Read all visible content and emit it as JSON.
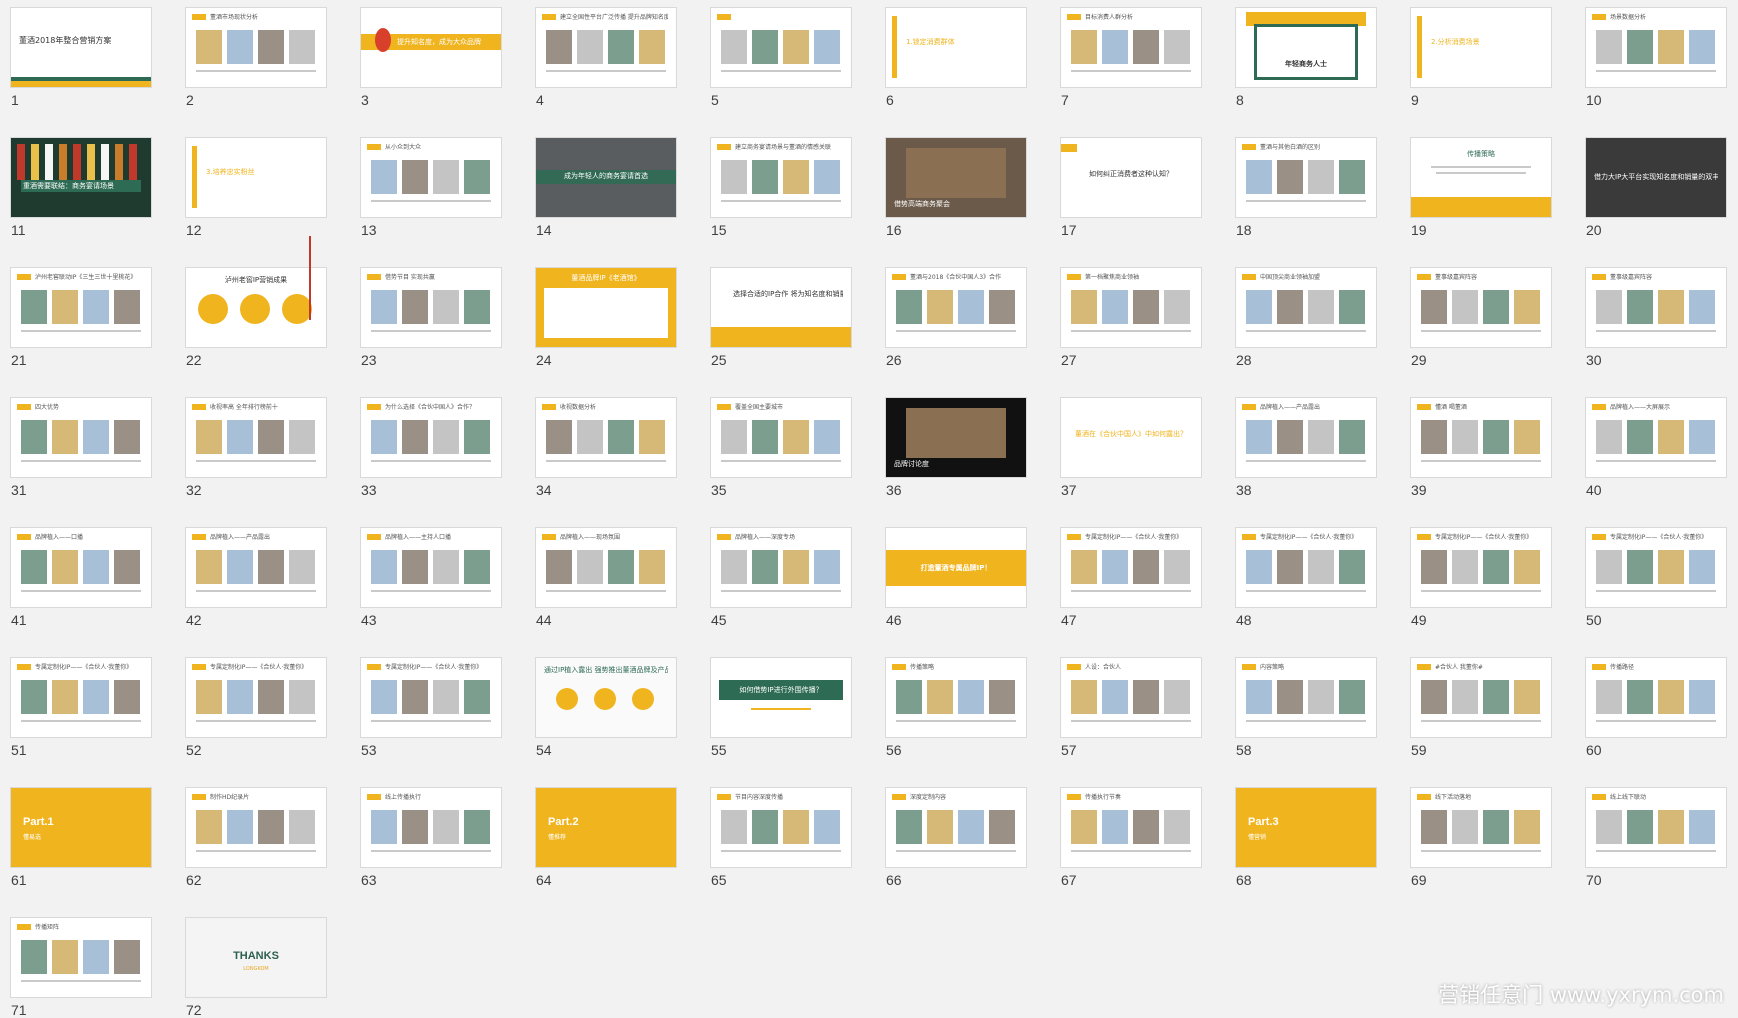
{
  "colors": {
    "background": "#f2f2f2",
    "accent_yellow": "#f0b41e",
    "brand_green": "#2e6b55",
    "dark": "#2b2b2b"
  },
  "slides": [
    {
      "number": "1",
      "style": "title",
      "text": "董酒2018年整合营销方案"
    },
    {
      "number": "2",
      "style": "content",
      "text": "董酒市场现状分析"
    },
    {
      "number": "3",
      "style": "band-yellow",
      "text": "提升知名度，成为大众品牌"
    },
    {
      "number": "4",
      "style": "image",
      "text": "建立全国性平台广泛传播 提升品牌知名度"
    },
    {
      "number": "5",
      "style": "green-blocks",
      "text": ""
    },
    {
      "number": "6",
      "style": "vbar",
      "text": "1.锁定消费群体"
    },
    {
      "number": "7",
      "style": "content",
      "text": "目标消费人群分析"
    },
    {
      "number": "8",
      "style": "green-frame",
      "text": "年轻商务人士"
    },
    {
      "number": "9",
      "style": "vbar",
      "text": "2.分析消费场景"
    },
    {
      "number": "10",
      "style": "content",
      "text": "场景数据分析"
    },
    {
      "number": "11",
      "style": "dark-band",
      "text": "重酒需要联结：商务宴请场景"
    },
    {
      "number": "12",
      "style": "vbar",
      "text": "3.培养忠实粉丝"
    },
    {
      "number": "13",
      "style": "circle-diagram",
      "text": "从小众到大众"
    },
    {
      "number": "14",
      "style": "photo-band",
      "text": "成为年轻人的商务宴请首选"
    },
    {
      "number": "15",
      "style": "arrow",
      "text": "建立商务宴请场景与董酒的情感关联"
    },
    {
      "number": "16",
      "style": "photo",
      "text": "借势高端商务聚会"
    },
    {
      "number": "17",
      "style": "question",
      "text": "如何纠正消费者这种认知？"
    },
    {
      "number": "18",
      "style": "content",
      "text": "董酒与其他白酒的区别"
    },
    {
      "number": "19",
      "style": "yellow-footer",
      "text": "传播策略"
    },
    {
      "number": "20",
      "style": "dark",
      "text": "借力大IP大平台实现知名度和销量的双丰收"
    },
    {
      "number": "21",
      "style": "content",
      "text": "泸州老窖联动IP《三生三世十里桃花》"
    },
    {
      "number": "22",
      "style": "circles-yellow",
      "text": "泸州老窖IP营销成果"
    },
    {
      "number": "23",
      "style": "photo-content",
      "text": "借势节目 实现共赢"
    },
    {
      "number": "24",
      "style": "yellow-chart",
      "text": "董酒品牌IP《老酒馆》"
    },
    {
      "number": "25",
      "style": "play-band",
      "text": "选择合适的IP合作 将为知名度和销量实现双赢"
    },
    {
      "number": "26",
      "style": "cross",
      "text": "董酒与2018《合伙中国人3》合作"
    },
    {
      "number": "27",
      "style": "photo-content",
      "text": "第一档聚焦商业领袖"
    },
    {
      "number": "28",
      "style": "content",
      "text": "中国顶尖商业领袖加盟"
    },
    {
      "number": "29",
      "style": "people",
      "text": "董事级嘉宾阵容"
    },
    {
      "number": "30",
      "style": "people",
      "text": "董事级嘉宾阵容"
    },
    {
      "number": "31",
      "style": "content",
      "text": "四大优势"
    },
    {
      "number": "32",
      "style": "logo-text",
      "text": "收视率高 全年排行榜前十"
    },
    {
      "number": "33",
      "style": "circles-photo",
      "text": "为什么选择《合伙中国人》合作？"
    },
    {
      "number": "34",
      "style": "chart",
      "text": "收视数据分析"
    },
    {
      "number": "35",
      "style": "map",
      "text": "覆盖全国主要城市"
    },
    {
      "number": "36",
      "style": "black-photo",
      "text": "品牌讨论度"
    },
    {
      "number": "37",
      "style": "question-yellow",
      "text": "董酒在《合伙中国人》中如何露出？"
    },
    {
      "number": "38",
      "style": "content",
      "text": "品牌植入——产品露出"
    },
    {
      "number": "39",
      "style": "photo-content",
      "text": "懂酒 喝董酒"
    },
    {
      "number": "40",
      "style": "photo-content",
      "text": "品牌植入——大屏展示"
    },
    {
      "number": "41",
      "style": "photo-content",
      "text": "品牌植入——口播"
    },
    {
      "number": "42",
      "style": "photo-content",
      "text": "品牌植入——产品露出"
    },
    {
      "number": "43",
      "style": "photo-content",
      "text": "品牌植入——主持人口播"
    },
    {
      "number": "44",
      "style": "photo-content",
      "text": "品牌植入——现场氛围"
    },
    {
      "number": "45",
      "style": "photo-content",
      "text": "品牌植入——深度专场"
    },
    {
      "number": "46",
      "style": "yellow-band",
      "text": "打造董酒专属品牌IP！"
    },
    {
      "number": "47",
      "style": "photo-band-dark",
      "text": "专属定制化IP——《合伙人·我董你》"
    },
    {
      "number": "48",
      "style": "icons",
      "text": "专属定制化IP——《合伙人·我董你》"
    },
    {
      "number": "49",
      "style": "icons",
      "text": "专属定制化IP——《合伙人·我董你》"
    },
    {
      "number": "50",
      "style": "avatars",
      "text": "专属定制化IP——《合伙人·我董你》"
    },
    {
      "number": "51",
      "style": "avatars",
      "text": "专属定制化IP——《合伙人·我董你》"
    },
    {
      "number": "52",
      "style": "avatars",
      "text": "专属定制化IP——《合伙人·我董你》"
    },
    {
      "number": "53",
      "style": "photo-content",
      "text": "专属定制化IP——《合伙人·我董你》"
    },
    {
      "number": "54",
      "style": "green-circles",
      "text": "通过IP植入露出 强势推出董酒品牌及产品"
    },
    {
      "number": "55",
      "style": "green-box",
      "text": "如何借势IP进行外围传播？"
    },
    {
      "number": "56",
      "style": "text",
      "text": "传播策略"
    },
    {
      "number": "57",
      "style": "person",
      "text": "人设：合伙人"
    },
    {
      "number": "58",
      "style": "text",
      "text": "内容策略"
    },
    {
      "number": "59",
      "style": "text",
      "text": "#合伙人 我董你#"
    },
    {
      "number": "60",
      "style": "flow",
      "text": "传播路径"
    },
    {
      "number": "61",
      "style": "part",
      "text": "Part.1",
      "sub": "懂易选"
    },
    {
      "number": "62",
      "style": "photo-content",
      "text": "制作HD纪录片"
    },
    {
      "number": "63",
      "style": "steps",
      "text": "线上传播执行"
    },
    {
      "number": "64",
      "style": "part",
      "text": "Part.2",
      "sub": "懂推荐"
    },
    {
      "number": "65",
      "style": "photo-content",
      "text": "节目内容深度传播"
    },
    {
      "number": "66",
      "style": "photo-content",
      "text": "深度定制内容"
    },
    {
      "number": "67",
      "style": "steps",
      "text": "传播执行节奏"
    },
    {
      "number": "68",
      "style": "part",
      "text": "Part.3",
      "sub": "懂营销"
    },
    {
      "number": "69",
      "style": "photo-content",
      "text": "线下活动落地"
    },
    {
      "number": "70",
      "style": "steps",
      "text": "线上线下联动"
    },
    {
      "number": "71",
      "style": "network",
      "text": "传播矩阵"
    },
    {
      "number": "72",
      "style": "thanks",
      "text": "THANKS",
      "sub": "LONGKOM"
    }
  ],
  "selection_marker_after": "22",
  "watermark": "营销任意门 www.yxrym.com"
}
